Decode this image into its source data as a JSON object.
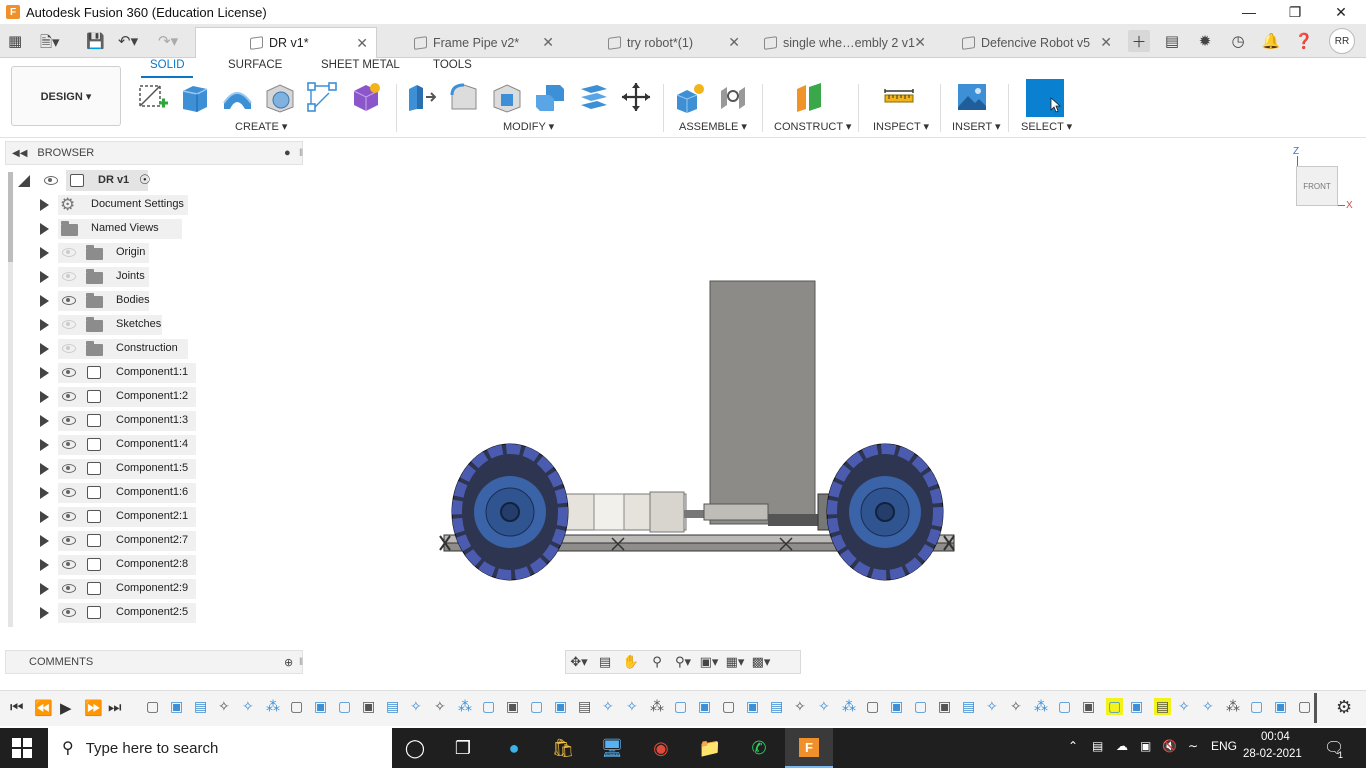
{
  "window": {
    "title": "Autodesk Fusion 360 (Education License)",
    "app_icon": "F"
  },
  "doc_tabs": [
    {
      "label": "DR v1*",
      "active": true
    },
    {
      "label": "Frame Pipe v2*"
    },
    {
      "label": "try robot*(1)"
    },
    {
      "label": "single whe…embly 2 v1"
    },
    {
      "label": "Defencive Robot v5"
    }
  ],
  "user": {
    "initials": "RR"
  },
  "toolbar": {
    "workspace": "DESIGN ▾",
    "tabs": [
      "SOLID",
      "SURFACE",
      "SHEET METAL",
      "TOOLS"
    ],
    "groups": [
      "CREATE ▾",
      "MODIFY ▾",
      "ASSEMBLE ▾",
      "CONSTRUCT ▾",
      "INSPECT ▾",
      "INSERT ▾",
      "SELECT ▾"
    ]
  },
  "browser": {
    "header": "BROWSER",
    "root": "DR v1",
    "items": [
      {
        "label": "Document Settings",
        "icon": "gear-icon",
        "eye": "none"
      },
      {
        "label": "Named Views",
        "icon": "folder-icon",
        "eye": "none"
      },
      {
        "label": "Origin",
        "icon": "folder-icon",
        "eye": "hidden"
      },
      {
        "label": "Joints",
        "icon": "folder-icon",
        "eye": "hidden"
      },
      {
        "label": "Bodies",
        "icon": "folder-icon",
        "eye": "visible"
      },
      {
        "label": "Sketches",
        "icon": "folder-icon",
        "eye": "hidden"
      },
      {
        "label": "Construction",
        "icon": "folder-icon",
        "eye": "hidden"
      },
      {
        "label": "Component1:1",
        "icon": "component-icon",
        "eye": "visible"
      },
      {
        "label": "Component1:2",
        "icon": "component-icon",
        "eye": "visible"
      },
      {
        "label": "Component1:3",
        "icon": "component-icon",
        "eye": "visible"
      },
      {
        "label": "Component1:4",
        "icon": "component-icon",
        "eye": "visible"
      },
      {
        "label": "Component1:5",
        "icon": "component-icon",
        "eye": "visible"
      },
      {
        "label": "Component1:6",
        "icon": "component-icon",
        "eye": "visible"
      },
      {
        "label": "Component2:1",
        "icon": "component-icon",
        "eye": "visible"
      },
      {
        "label": "Component2:7",
        "icon": "component-icon",
        "eye": "visible"
      },
      {
        "label": "Component2:8",
        "icon": "component-icon",
        "eye": "visible"
      },
      {
        "label": "Component2:9",
        "icon": "component-icon",
        "eye": "visible"
      },
      {
        "label": "Component2:5",
        "icon": "component-icon",
        "eye": "visible"
      }
    ]
  },
  "comments": {
    "label": "COMMENTS"
  },
  "viewcube": {
    "face": "FRONT",
    "axis_z": "Z",
    "axis_x": "X"
  },
  "taskbar": {
    "search_placeholder": "Type here to search",
    "lang": "ENG",
    "time": "00:04",
    "date": "28-02-2021",
    "notifications": "1"
  }
}
